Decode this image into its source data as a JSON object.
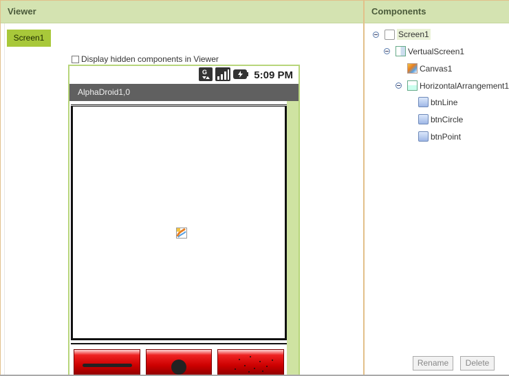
{
  "viewer": {
    "header": "Viewer",
    "screen_button": "Screen1",
    "hidden_components_label": "Display hidden components in Viewer",
    "hidden_components_checked": false
  },
  "phone": {
    "time": "5:09 PM",
    "app_title": "AlphaDroid1,0",
    "status_icons": [
      "network-icon",
      "signal-icon",
      "battery-icon"
    ],
    "buttons": [
      {
        "name": "btnLine",
        "glyph": "line-icon"
      },
      {
        "name": "btnCircle",
        "glyph": "circle-icon"
      },
      {
        "name": "btnPoint",
        "glyph": "dots-icon"
      }
    ],
    "button_color": "#cc0000"
  },
  "components": {
    "header": "Components",
    "tree": [
      {
        "label": "Screen1",
        "level": 0,
        "icon": "screen-icon",
        "selected": true
      },
      {
        "label": "VertualScreen1",
        "level": 1,
        "icon": "vertical-arrangement-icon"
      },
      {
        "label": "Canvas1",
        "level": 2,
        "icon": "canvas-icon"
      },
      {
        "label": "HorizontalArrangement1",
        "level": 2,
        "icon": "horizontal-arrangement-icon"
      },
      {
        "label": "btnLine",
        "level": 3,
        "icon": "button-icon"
      },
      {
        "label": "btnCircle",
        "level": 3,
        "icon": "button-icon"
      },
      {
        "label": "btnPoint",
        "level": 3,
        "icon": "button-icon"
      }
    ],
    "rename_label": "Rename",
    "delete_label": "Delete"
  },
  "colors": {
    "header_bg": "#d4e3b1",
    "accent": "#a8c83a",
    "title_bar": "#606060"
  }
}
